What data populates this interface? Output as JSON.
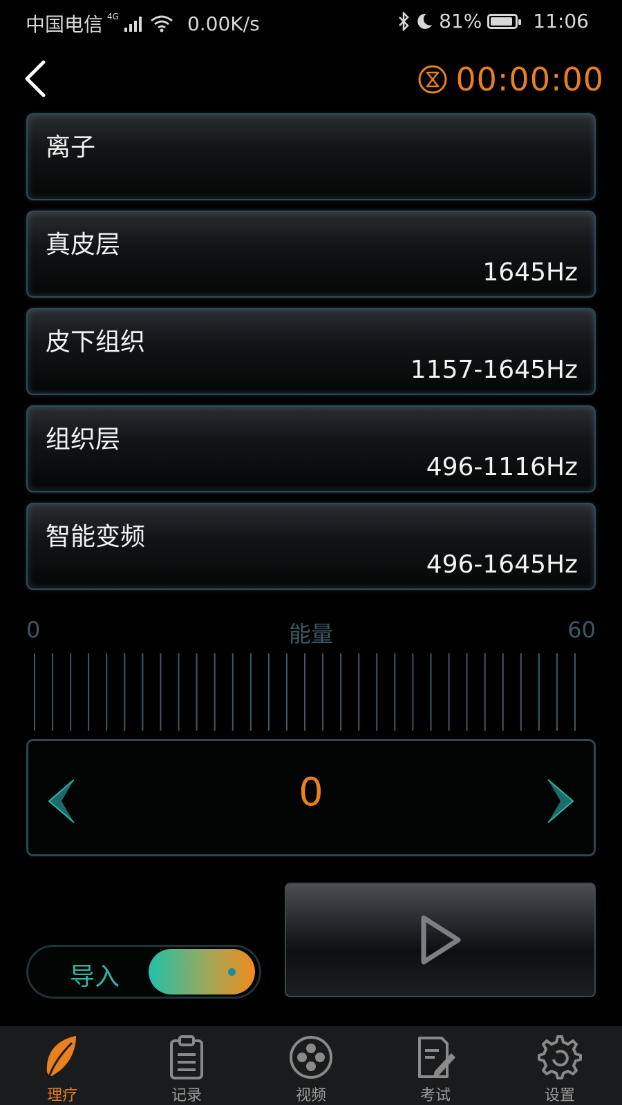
{
  "status_bar": {
    "carrier": "中国电信",
    "network_type": "4G",
    "speed": "0.00K/s",
    "battery": "81%",
    "time": "11:06"
  },
  "header": {
    "back_icon": "chevron-left-icon",
    "timer_icon": "hourglass-icon",
    "timer": "00:00:00"
  },
  "modes": [
    {
      "title": "离子",
      "freq": ""
    },
    {
      "title": "真皮层",
      "freq": "1645Hz"
    },
    {
      "title": "皮下组织",
      "freq": "1157-1645Hz"
    },
    {
      "title": "组织层",
      "freq": "496-1116Hz"
    },
    {
      "title": "智能变频",
      "freq": "496-1645Hz"
    }
  ],
  "energy": {
    "label": "能量",
    "min": "0",
    "max": "60",
    "value": "0"
  },
  "toggle": {
    "label": "导入"
  },
  "play_button": {
    "icon": "play-icon"
  },
  "bottom_nav": [
    {
      "label": "理疗",
      "icon": "leaf-icon",
      "active": true
    },
    {
      "label": "记录",
      "icon": "clipboard-icon",
      "active": false
    },
    {
      "label": "视频",
      "icon": "film-reel-icon",
      "active": false
    },
    {
      "label": "考试",
      "icon": "exam-icon",
      "active": false
    },
    {
      "label": "设置",
      "icon": "gear-icon",
      "active": false
    }
  ],
  "colors": {
    "accent": "#e8801e",
    "teal": "#2fb7a5",
    "background": "#000000"
  }
}
